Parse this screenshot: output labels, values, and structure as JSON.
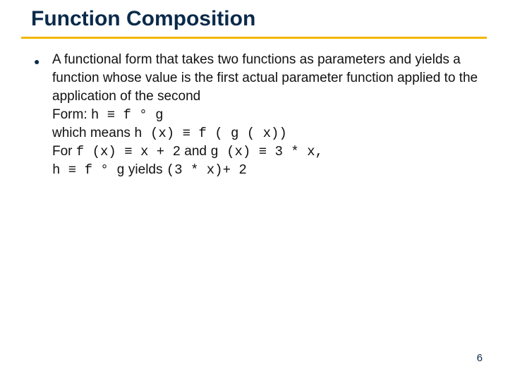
{
  "title": "Function Composition",
  "bullet_glyph": "●",
  "content": {
    "intro": "A functional form that takes two functions as parameters and yields a function whose value is the first actual parameter function applied to the application of the second",
    "form_label": "Form: ",
    "form_expr": "h ≡ f ° g",
    "means_prefix": "which means ",
    "means_expr": "h (x) ≡ f ( g ( x))",
    "for_prefix": "For ",
    "for_f": "f (x) ≡ x + 2",
    "and_word": " and ",
    "for_g": "g (x) ≡ 3 * x,",
    "h_def": "h ≡ f ° g",
    "yields_word": " yields ",
    "result_expr": "(3 * x)+ 2"
  },
  "page_number": "6"
}
